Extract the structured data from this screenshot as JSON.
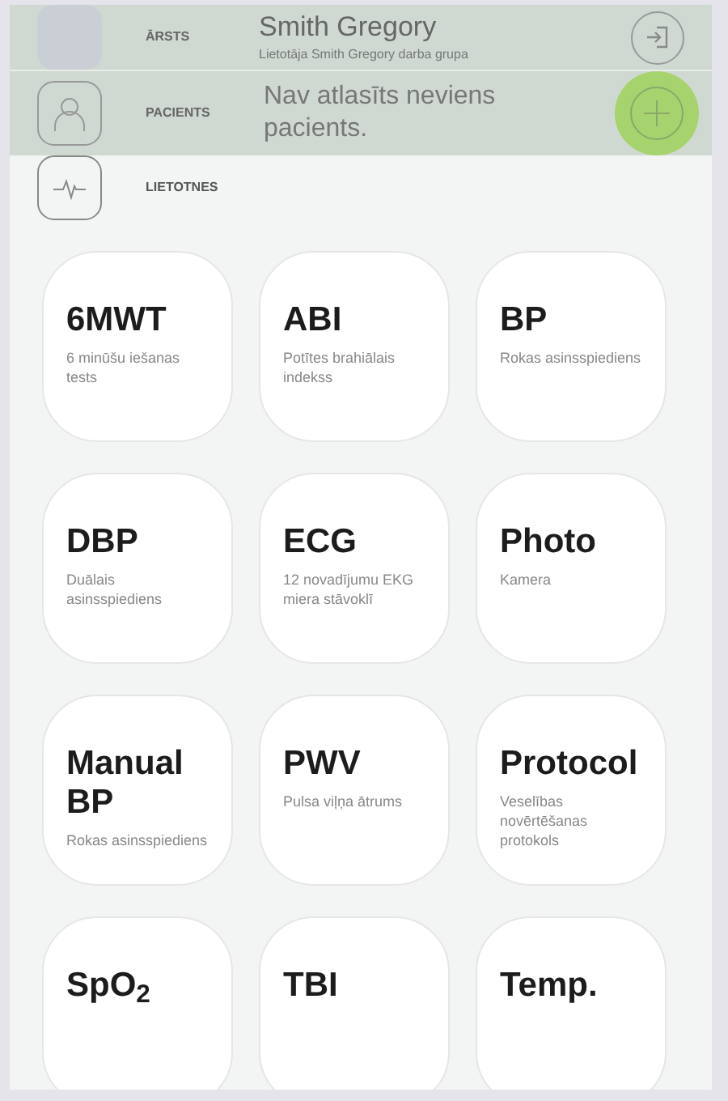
{
  "doctor": {
    "label": "ĀRSTS",
    "name": "Smith Gregory",
    "group": "Lietotāja Smith Gregory darba grupa"
  },
  "patient": {
    "label": "PACIENTS",
    "text": "Nav atlasīts neviens pacients."
  },
  "apps_header": {
    "label": "LIETOTNES"
  },
  "apps": [
    {
      "title": "6MWT",
      "subtitle": "6 minūšu iešanas tests"
    },
    {
      "title": "ABI",
      "subtitle": "Potītes brahiālais indekss"
    },
    {
      "title": "BP",
      "subtitle": "Rokas asinsspiediens"
    },
    {
      "title": "DBP",
      "subtitle": "Duālais asinsspiediens"
    },
    {
      "title": "ECG",
      "subtitle": "12 novadījumu EKG miera stāvoklī"
    },
    {
      "title": "Photo",
      "subtitle": "Kamera"
    },
    {
      "title": "Manual BP",
      "subtitle": "Rokas asinsspiediens"
    },
    {
      "title": "PWV",
      "subtitle": "Pulsa viļņa ātrums"
    },
    {
      "title": "Protocol",
      "subtitle": "Veselības novērtēšanas protokols"
    },
    {
      "title": "SpO$_{2}$"
    },
    {
      "title": "TBI"
    },
    {
      "title": "Temp."
    }
  ]
}
